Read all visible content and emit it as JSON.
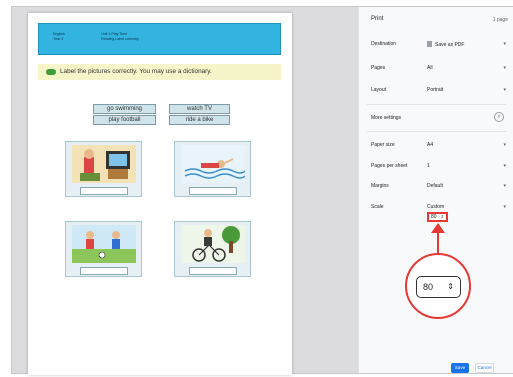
{
  "worksheet": {
    "header_left": [
      "English",
      "Year 3"
    ],
    "header_right": [
      "Unit 1 Play Time",
      "Reading Label correctly"
    ],
    "instruction": "Label the pictures correctly. You may use a dictionary.",
    "words": [
      "go swimming",
      "watch TV",
      "play football",
      "ride a bike"
    ]
  },
  "print_panel": {
    "title": "Print",
    "pages_count": "1 page",
    "destination_label": "Destination",
    "destination_value": "Save as PDF",
    "pages_label": "Pages",
    "pages_value": "All",
    "layout_label": "Layout",
    "layout_value": "Portrait",
    "more_settings_label": "More settings",
    "paper_size_label": "Paper size",
    "paper_size_value": "A4",
    "pages_per_sheet_label": "Pages per sheet",
    "pages_per_sheet_value": "1",
    "margins_label": "Margins",
    "margins_value": "Default",
    "scale_label": "Scale",
    "scale_value": "Custom",
    "scale_input": "80",
    "zoom_scale_input": "80",
    "save_label": "Save",
    "cancel_label": "Cancel"
  },
  "icons": {
    "caret": "chevron-down-icon",
    "expand": "chevron-up-icon",
    "spinner": "spinner-icon",
    "pdf": "document-icon"
  },
  "colors": {
    "highlight": "#e53935",
    "primary": "#1a73e8",
    "header_band": "#33b4e0"
  }
}
